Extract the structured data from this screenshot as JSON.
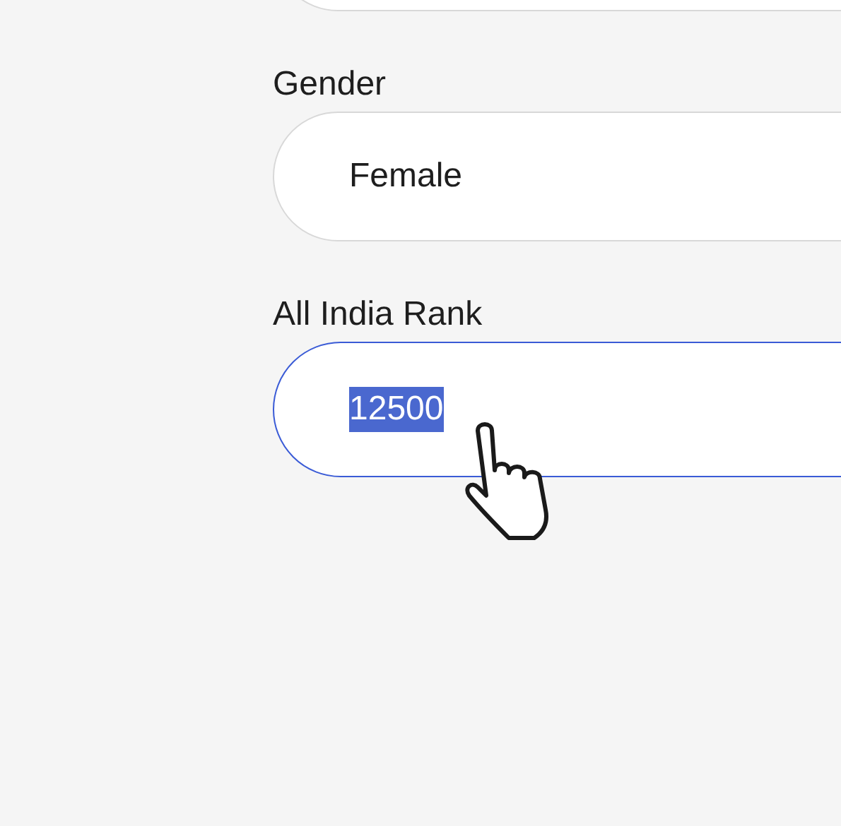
{
  "fields": [
    {
      "label": "Gender",
      "value": "Female",
      "focused": false,
      "text_selected": false
    },
    {
      "label": "All India Rank",
      "value": "12500",
      "focused": true,
      "text_selected": true
    }
  ]
}
